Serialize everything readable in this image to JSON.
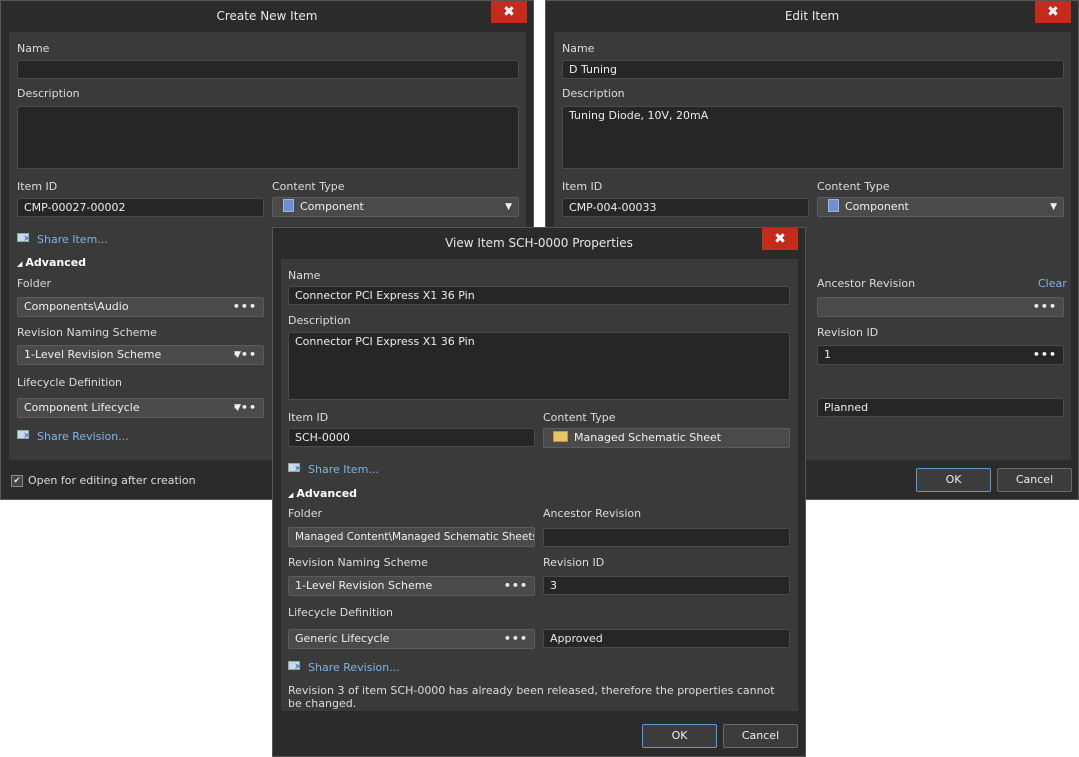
{
  "create": {
    "title": "Create New Item",
    "close_glyph": "✖",
    "name_label": "Name",
    "name_value": "",
    "description_label": "Description",
    "description_value": "",
    "item_id_label": "Item ID",
    "item_id_value": "CMP-00027-00002",
    "content_type_label": "Content Type",
    "content_type_value": "Component",
    "share_item": "Share Item...",
    "advanced": "Advanced",
    "folder_label": "Folder",
    "folder_value": "Components\\Audio",
    "naming_label": "Revision Naming Scheme",
    "naming_value": "1-Level Revision Scheme",
    "lifecycle_label": "Lifecycle Definition",
    "lifecycle_value": "Component Lifecycle",
    "share_revision": "Share Revision...",
    "open_editing": "Open for editing after creation",
    "checked": "✔"
  },
  "edit": {
    "title": "Edit Item",
    "close_glyph": "✖",
    "name_label": "Name",
    "name_value": "D Tuning",
    "description_label": "Description",
    "description_value": "Tuning Diode, 10V, 20mA",
    "item_id_label": "Item ID",
    "item_id_value": "CMP-004-00033",
    "content_type_label": "Content Type",
    "content_type_value": "Component",
    "ancestor_label": "Ancestor Revision",
    "clear_link": "Clear",
    "ancestor_value": "",
    "revision_id_label": "Revision ID",
    "revision_id_value": "1",
    "lifecycle_state": "Planned",
    "ok": "OK",
    "cancel": "Cancel"
  },
  "view": {
    "title": "View Item SCH-0000 Properties",
    "close_glyph": "✖",
    "name_label": "Name",
    "name_value": "Connector PCI Express X1 36 Pin",
    "description_label": "Description",
    "description_value": "Connector PCI Express X1 36 Pin",
    "item_id_label": "Item ID",
    "item_id_value": "SCH-0000",
    "content_type_label": "Content Type",
    "content_type_value": "Managed Schematic Sheet",
    "share_item": "Share Item...",
    "advanced": "Advanced",
    "folder_label": "Folder",
    "folder_value": "Managed Content\\Managed Schematic Sheets",
    "ancestor_label": "Ancestor Revision",
    "ancestor_value": "",
    "naming_label": "Revision Naming Scheme",
    "naming_value": "1-Level Revision Scheme",
    "revision_id_label": "Revision ID",
    "revision_id_value": "3",
    "lifecycle_label": "Lifecycle Definition",
    "lifecycle_value": "Generic Lifecycle",
    "lifecycle_state": "Approved",
    "share_revision": "Share Revision...",
    "message": "Revision 3 of item SCH-0000 has already been released, therefore the properties cannot be changed.",
    "ok": "OK",
    "cancel": "Cancel"
  },
  "glyphs": {
    "dots": "•••",
    "caret": "▼",
    "triangle": "◢"
  },
  "colors": {
    "dialog_bg": "#2b2b2b",
    "panel_bg": "#3a3a3a",
    "close_red": "#c42b1c",
    "link_blue": "#7fb3e8",
    "primary_border": "#5a9ad6"
  }
}
